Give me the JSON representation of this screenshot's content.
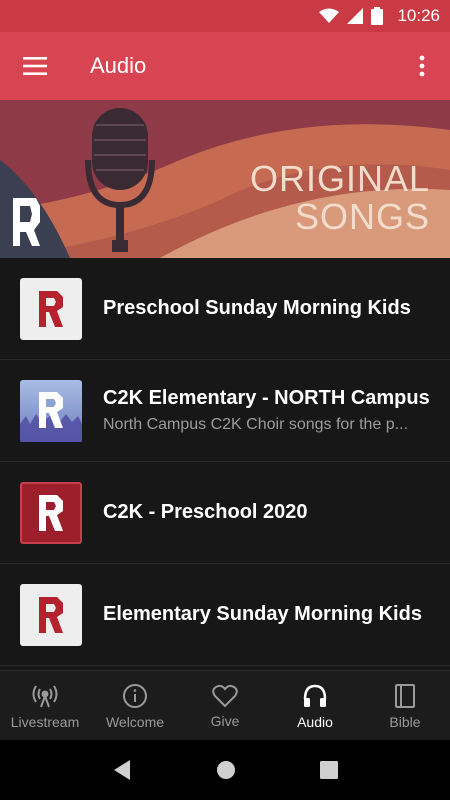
{
  "status_bar": {
    "time": "10:26"
  },
  "app_bar": {
    "title": "Audio"
  },
  "banner": {
    "line1": "ORIGINAL",
    "line2": "SONGS"
  },
  "items": [
    {
      "title": "Preschool Sunday Morning Kids",
      "subtitle": ""
    },
    {
      "title": "C2K Elementary - NORTH Campus",
      "subtitle": "North Campus C2K Choir songs for the p..."
    },
    {
      "title": "C2K - Preschool 2020",
      "subtitle": ""
    },
    {
      "title": "Elementary Sunday Morning Kids",
      "subtitle": ""
    }
  ],
  "nav": [
    {
      "label": "Livestream",
      "icon": "broadcast-icon"
    },
    {
      "label": "Welcome",
      "icon": "info-icon"
    },
    {
      "label": "Give",
      "icon": "heart-icon"
    },
    {
      "label": "Audio",
      "icon": "headphones-icon",
      "active": true
    },
    {
      "label": "Bible",
      "icon": "book-icon"
    }
  ],
  "colors": {
    "app_bar": "#d94452",
    "status_bar": "#c93a44",
    "background": "#171717",
    "brand_red": "#b5222e"
  }
}
